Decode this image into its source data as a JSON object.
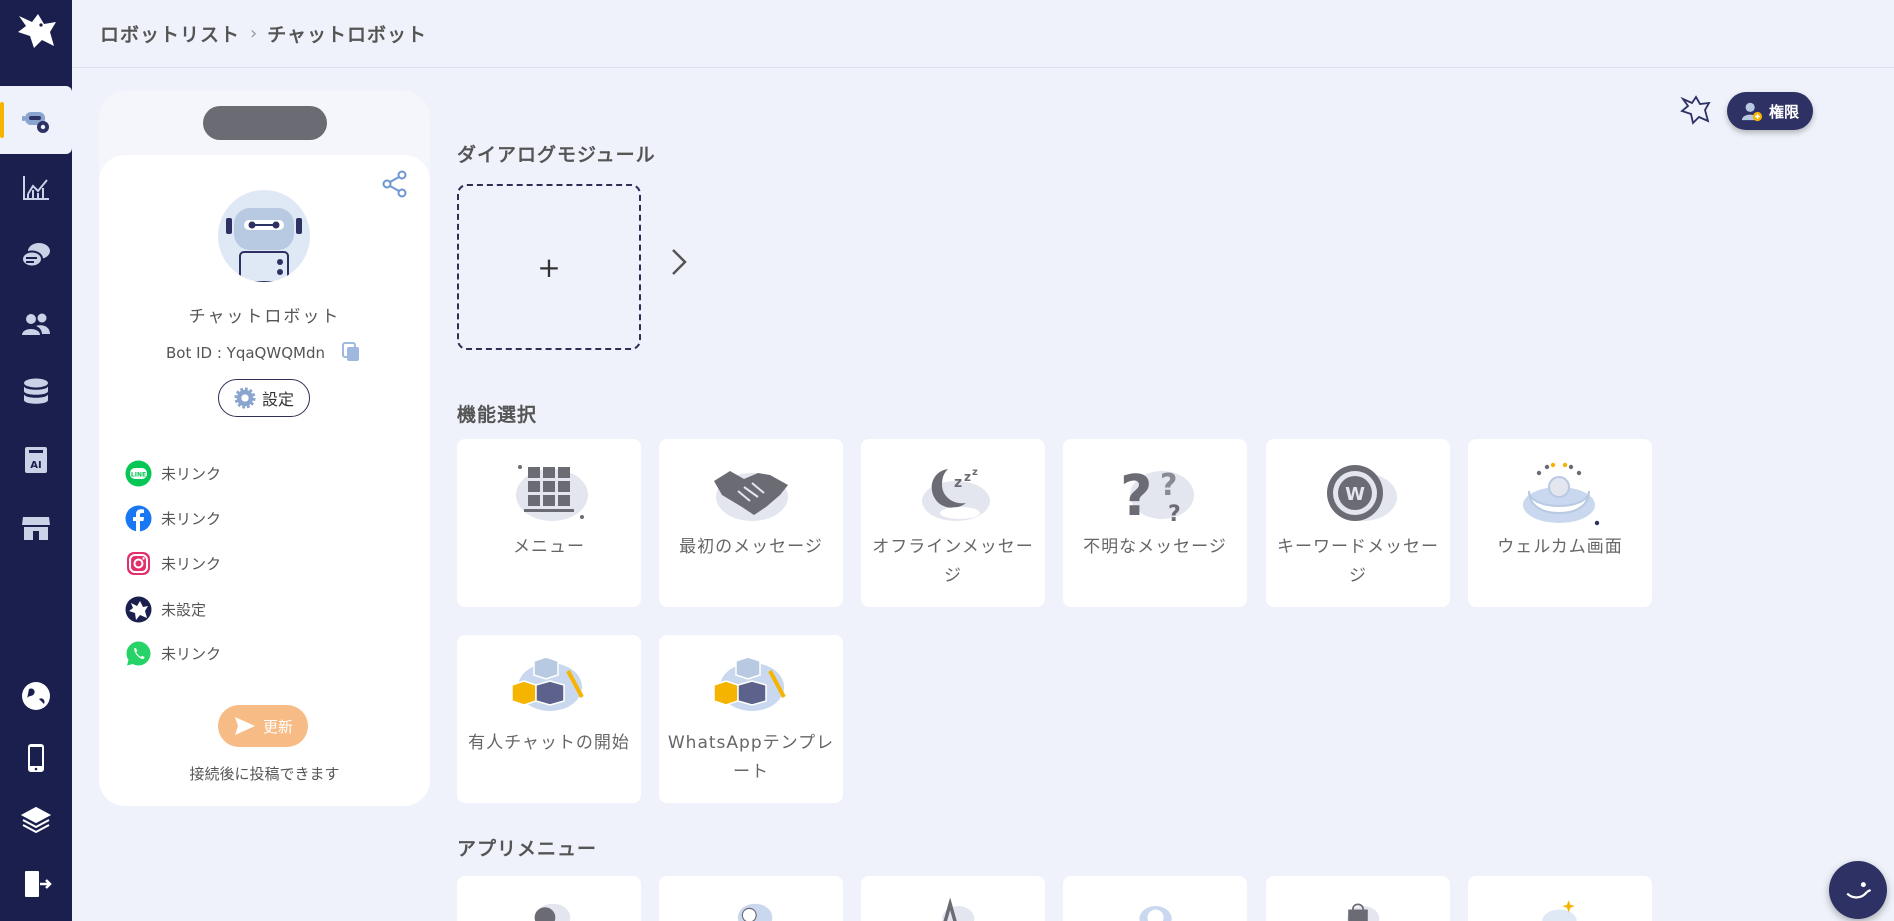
{
  "header": {
    "breadcrumb": [
      "ロボットリスト",
      "チャットロボット"
    ]
  },
  "sidebar": {
    "items": [
      {
        "icon": "robot-settings-icon",
        "active": true
      },
      {
        "icon": "analytics-chart-icon"
      },
      {
        "icon": "chat-bubbles-icon"
      },
      {
        "icon": "users-icon"
      },
      {
        "icon": "database-icon"
      },
      {
        "icon": "ai-document-icon"
      },
      {
        "icon": "store-icon"
      },
      {
        "icon": "globe-icon"
      },
      {
        "icon": "mobile-icon"
      },
      {
        "icon": "layers-icon"
      },
      {
        "icon": "logout-icon"
      }
    ]
  },
  "bot": {
    "name": "チャットロボット",
    "id_text": "Bot ID : YqaQWQMdn",
    "settings_label": "設定",
    "channels": [
      {
        "icon": "line-icon",
        "status": "未リンク"
      },
      {
        "icon": "facebook-icon",
        "status": "未リンク"
      },
      {
        "icon": "instagram-icon",
        "status": "未リンク"
      },
      {
        "icon": "custom-channel-icon",
        "status": "未設定"
      },
      {
        "icon": "whatsapp-icon",
        "status": "未リンク"
      }
    ],
    "update_label": "更新",
    "update_hint": "接続後に投稿できます"
  },
  "top_right": {
    "permission_label": "権限"
  },
  "sections": {
    "dialog": "ダイアログモジュール",
    "add_symbol": "+",
    "features": "機能選択",
    "app_menu": "アプリメニュー"
  },
  "features": [
    {
      "label": "メニュー",
      "icon": "menu-grid-icon"
    },
    {
      "label": "最初のメッセージ",
      "icon": "handshake-icon"
    },
    {
      "label": "オフラインメッセージ",
      "icon": "sleep-moon-icon"
    },
    {
      "label": "不明なメッセージ",
      "icon": "question-icon"
    },
    {
      "label": "キーワードメッセージ",
      "icon": "keyword-target-icon"
    },
    {
      "label": "ウェルカム画面",
      "icon": "welcome-icon"
    },
    {
      "label": "有人チャットの開始",
      "icon": "cubes-icon"
    },
    {
      "label": "WhatsAppテンプレート",
      "icon": "cubes-template-icon"
    }
  ],
  "colors": {
    "sidebar_bg": "#1b1f4d",
    "page_bg": "#eff2fa",
    "accent_yellow": "#f5b400",
    "update_orange": "#f7bb85",
    "permission_navy": "#2d3163"
  }
}
